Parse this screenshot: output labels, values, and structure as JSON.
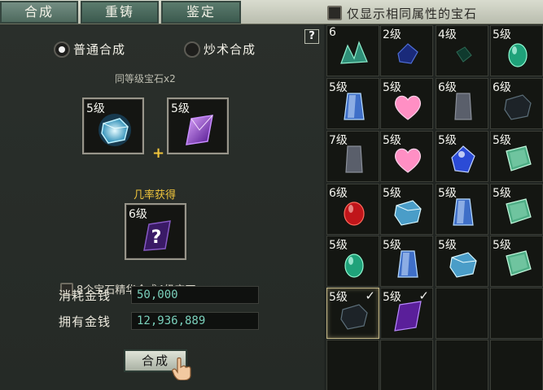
{
  "tabs": [
    {
      "label": "合成",
      "active": true
    },
    {
      "label": "重铸",
      "active": false
    },
    {
      "label": "鉴定",
      "active": false
    }
  ],
  "filter": {
    "label": "仅显示相同属性的宝石",
    "checked": false
  },
  "help_label": "?",
  "mode": {
    "normal": "普通合成",
    "magic": "炒术合成",
    "selected": "normal"
  },
  "requirement": "同等级宝石x2",
  "input_slots": [
    {
      "level": "5级",
      "gem": "ice-cube-gem"
    },
    {
      "level": "5级",
      "gem": "purple-crystal-gem"
    }
  ],
  "chance_label": "几率获得",
  "output_slot": {
    "level": "6级",
    "gem": "unknown-purple-gem",
    "symbol": "?"
  },
  "essence_option": {
    "label": "8个宝石精华合成4级宝石",
    "checked": false
  },
  "cost": {
    "label": "消耗金钱",
    "value": "50,000"
  },
  "owned": {
    "label": "拥有金钱",
    "value": "12,936,889"
  },
  "craft_button": "合成",
  "colors": {
    "accent_gold": "#f0c53c",
    "money_text": "#7ad0bb"
  },
  "inventory": [
    [
      {
        "level": "6",
        "gem": "green-cluster"
      },
      {
        "level": "2级",
        "gem": "dark-blue"
      },
      {
        "level": "4级",
        "gem": "dark-green"
      },
      {
        "level": "5级",
        "gem": "green-drop"
      }
    ],
    [
      {
        "level": "5级",
        "gem": "blue-crystal"
      },
      {
        "level": "5级",
        "gem": "pink-heart"
      },
      {
        "level": "6级",
        "gem": "gray-crystal"
      },
      {
        "level": "6级",
        "gem": "dark-cube"
      }
    ],
    [
      {
        "level": "7级",
        "gem": "gray-crystal"
      },
      {
        "level": "5级",
        "gem": "pink-heart"
      },
      {
        "level": "5级",
        "gem": "blue-gem"
      },
      {
        "level": "5级",
        "gem": "green-tile"
      }
    ],
    [
      {
        "level": "6级",
        "gem": "red-drop"
      },
      {
        "level": "5级",
        "gem": "ice-cube"
      },
      {
        "level": "5级",
        "gem": "blue-crystal"
      },
      {
        "level": "5级",
        "gem": "green-tile"
      }
    ],
    [
      {
        "level": "5级",
        "gem": "green-drop"
      },
      {
        "level": "5级",
        "gem": "blue-crystal"
      },
      {
        "level": "5级",
        "gem": "ice-cube"
      },
      {
        "level": "5级",
        "gem": "green-tile"
      }
    ],
    [
      {
        "level": "5级",
        "gem": "dark-cube",
        "selected": true,
        "check": "✓"
      },
      {
        "level": "5级",
        "gem": "purple-crystal",
        "selected": false,
        "check": "✓"
      },
      {
        "level": "",
        "gem": ""
      },
      {
        "level": "",
        "gem": ""
      }
    ],
    [
      {
        "level": "",
        "gem": ""
      },
      {
        "level": "",
        "gem": ""
      },
      {
        "level": "",
        "gem": ""
      },
      {
        "level": "",
        "gem": ""
      }
    ]
  ]
}
